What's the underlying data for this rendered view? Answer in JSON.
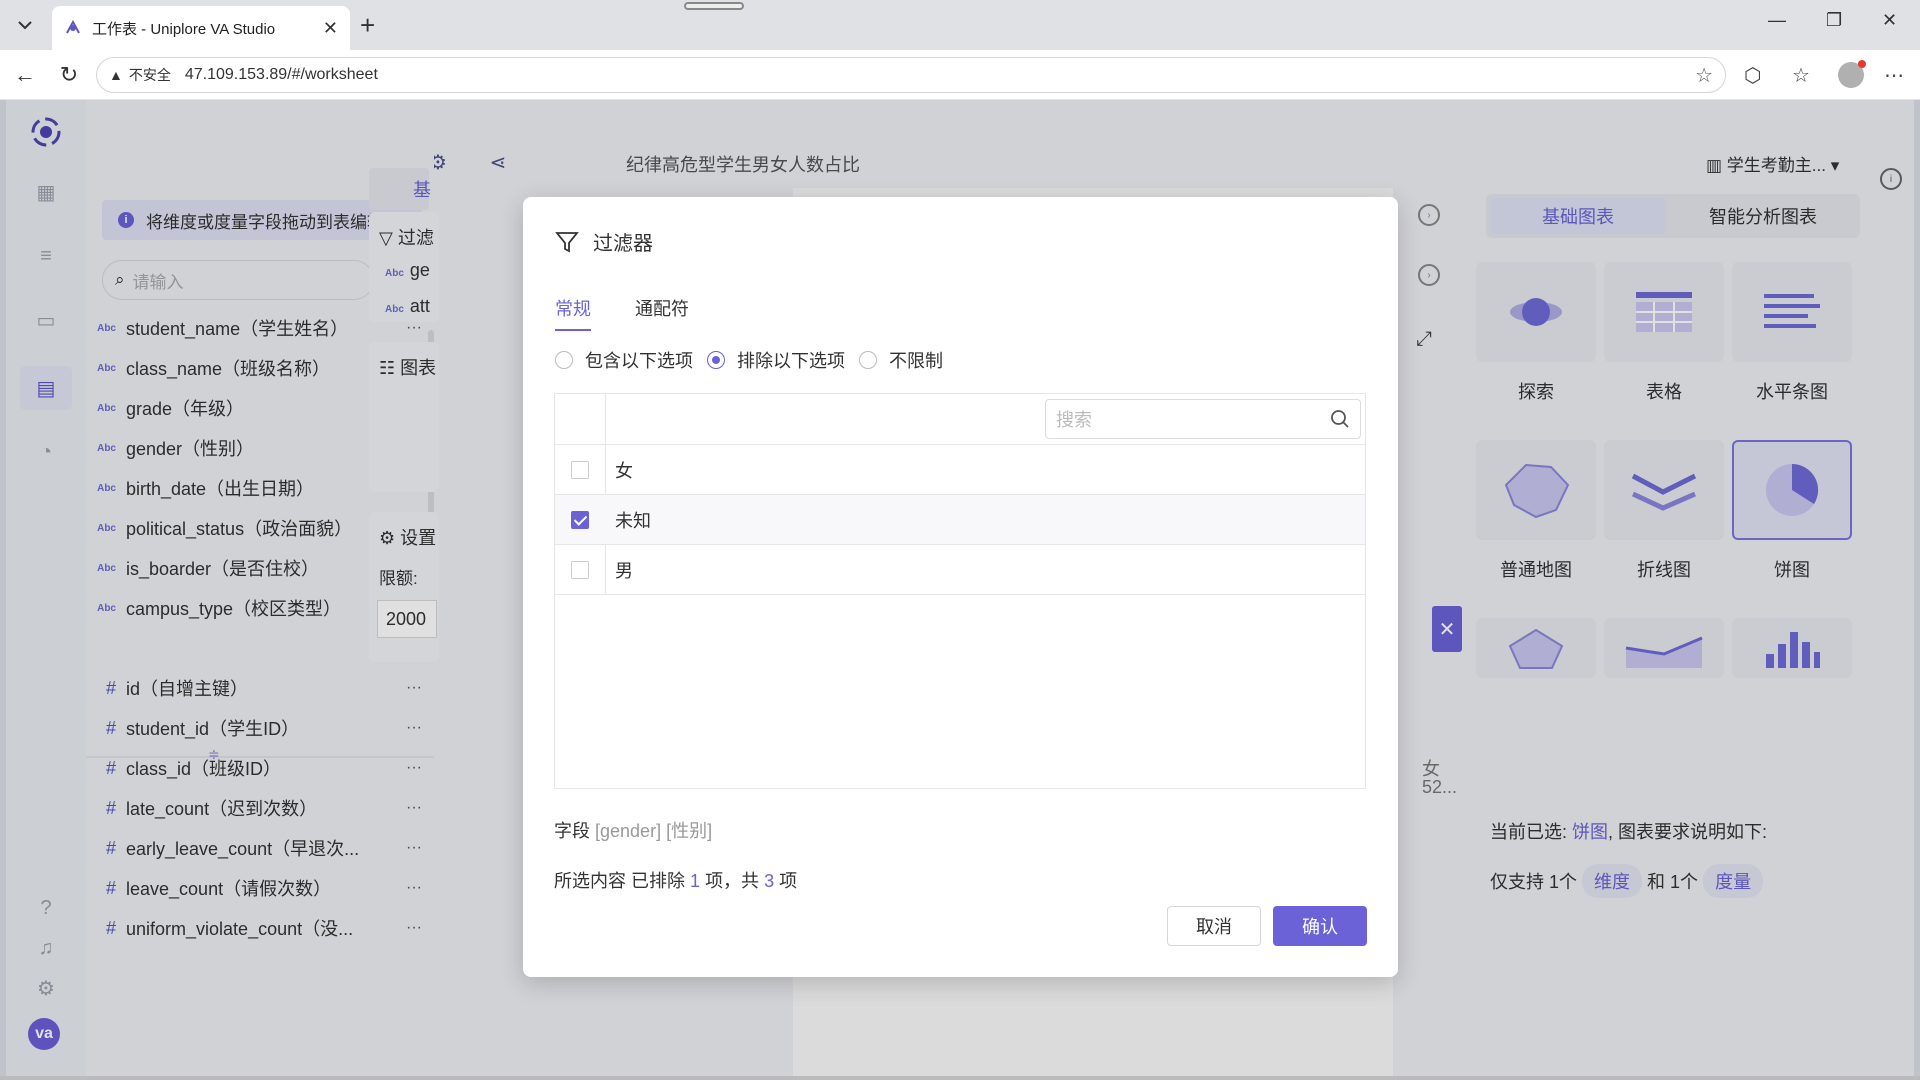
{
  "browser": {
    "tab_title": "工作表 - Uniplore VA Studio",
    "address_security": "不安全",
    "url": "47.109.153.89/#/worksheet"
  },
  "toolbar": {
    "sheet_title": "纪律高危型学生男女人数占比",
    "datasource": "学生考勤主..."
  },
  "field_panel": {
    "hint": "将维度或度量字段拖动到表编辑区",
    "search_placeholder": "请输入",
    "dimensions": [
      {
        "type": "Abc",
        "label": "student_name（学生姓名）"
      },
      {
        "type": "Abc",
        "label": "class_name（班级名称）"
      },
      {
        "type": "Abc",
        "label": "grade（年级）"
      },
      {
        "type": "Abc",
        "label": "gender（性别）"
      },
      {
        "type": "Abc",
        "label": "birth_date（出生日期）"
      },
      {
        "type": "Abc",
        "label": "political_status（政治面貌）"
      },
      {
        "type": "Abc",
        "label": "is_boarder（是否住校）"
      },
      {
        "type": "Abc",
        "label": "campus_type（校区类型）"
      }
    ],
    "measures": [
      {
        "type": "#",
        "label": "id（自增主键）"
      },
      {
        "type": "#",
        "label": "student_id（学生ID）"
      },
      {
        "type": "#",
        "label": "class_id（班级ID）"
      },
      {
        "type": "#",
        "label": "late_count（迟到次数）"
      },
      {
        "type": "#",
        "label": "early_leave_count（早退次..."
      },
      {
        "type": "#",
        "label": "leave_count（请假次数）"
      },
      {
        "type": "#",
        "label": "uniform_violate_count（没..."
      }
    ],
    "more": "···"
  },
  "mid_panel": {
    "tab_label": "基",
    "filter_head": "过滤",
    "filter_items": [
      "ge",
      "att"
    ],
    "chart_head": "图表",
    "settings_head": "设置",
    "limit_label": "限额:",
    "limit_value": "2000",
    "type_tag": "Abc"
  },
  "chart_peek": {
    "label_line1": "女",
    "label_line2": "52..."
  },
  "right_panel": {
    "tabs": [
      "基础图表",
      "智能分析图表"
    ],
    "charts": [
      "探索",
      "表格",
      "水平条图",
      "普通地图",
      "折线图",
      "饼图"
    ],
    "desc_prefix": "当前已选:",
    "desc_selected": "饼图",
    "desc_suffix": ", 图表要求说明如下:",
    "req_prefix": "仅支持 1个",
    "req_dim": "维度",
    "req_mid": "和 1个",
    "req_measure": "度量"
  },
  "modal": {
    "title": "过滤器",
    "tabs": [
      "常规",
      "通配符"
    ],
    "radios": [
      "包含以下选项",
      "排除以下选项",
      "不限制"
    ],
    "search_placeholder": "搜索",
    "values": [
      {
        "label": "女",
        "checked": false
      },
      {
        "label": "未知",
        "checked": true
      },
      {
        "label": "男",
        "checked": false
      }
    ],
    "field_label": "字段",
    "field_tag1": "[gender]",
    "field_tag2": "[性别]",
    "summary_prefix": "所选内容 已排除",
    "excluded_count": "1",
    "summary_mid": "项，共",
    "total_count": "3",
    "summary_suffix": "项",
    "cancel": "取消",
    "confirm": "确认"
  },
  "colors": {
    "accent": "#6a62d6"
  }
}
